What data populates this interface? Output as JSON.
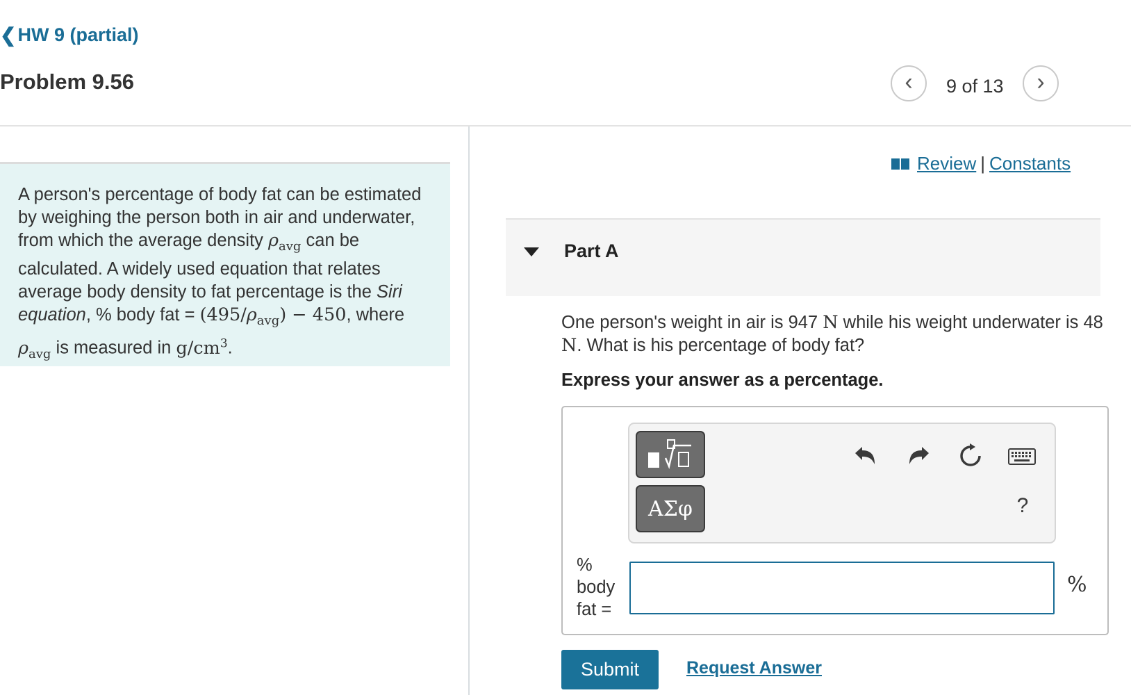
{
  "header": {
    "back_chevron": "❮",
    "back_label": "HW 9 (partial)",
    "title": "Problem 9.56",
    "pager": {
      "prev": "‹",
      "text": "9 of 13",
      "next": "›"
    }
  },
  "context": {
    "text_1": "A person's percentage of body fat can be estimated by weighing the person both in air and underwater, from which the average density ",
    "rho": "ρ",
    "avg_sub": "avg",
    "text_2": " can be calculated. A widely used equation that relates average body density to fat percentage is the ",
    "siri": "Siri equation",
    "text_3": ", % body fat = ",
    "eq_1": "(495/",
    "eq_2": ") − 450",
    "text_4": ", where ",
    "text_5": " is measured in ",
    "units": "g/cm",
    "units_sup": "3",
    "text_6": "."
  },
  "links": {
    "review": "Review",
    "separator": "|",
    "constants": "Constants"
  },
  "part": {
    "label": "Part A"
  },
  "question": {
    "text_1": "One person's weight in air is 947 ",
    "unit_n": "N",
    "text_2": " while his weight underwater is 48 ",
    "text_3": ". What is his percentage of body fat?"
  },
  "instruction": "Express your answer as a percentage.",
  "toolbar": {
    "templates_icon": "template-icon",
    "greek_label": "ΑΣφ",
    "undo": "undo-icon",
    "redo": "redo-icon",
    "reset": "reset-icon",
    "keyboard": "keyboard-icon",
    "help": "?"
  },
  "answer": {
    "label_line1": "%",
    "label_line2": "body",
    "label_line3": "fat =",
    "value": "",
    "unit": "%"
  },
  "actions": {
    "submit": "Submit",
    "request_answer": "Request Answer"
  },
  "colors": {
    "accent": "#1a6d96",
    "context_bg": "#e5f4f4",
    "button": "#1a7299"
  }
}
